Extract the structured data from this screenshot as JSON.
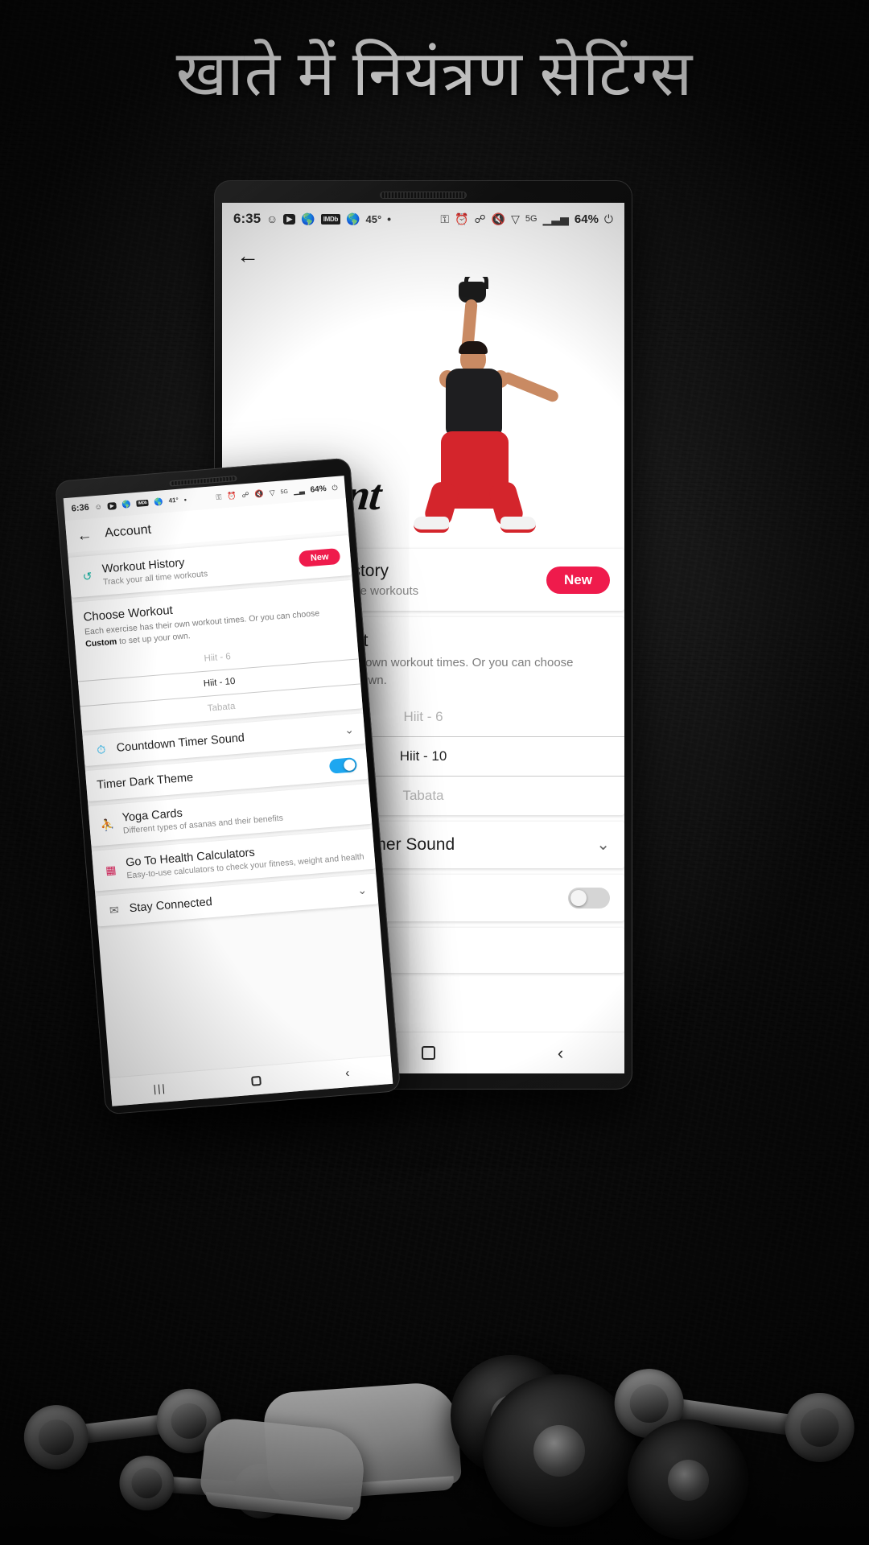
{
  "headline": "खाते में नियंत्रण सेटिंग्स",
  "colors": {
    "accent_red": "#ef1b4c",
    "accent_blue": "#1ea7f0",
    "teal": "#16b8a6",
    "backdrop": "#0b0b0b"
  },
  "tablet": {
    "status_bar": {
      "time": "6:35",
      "temperature": "45°",
      "battery": "64%",
      "left_icons": [
        "snapchat-icon",
        "youtube-icon",
        "globe-alert-icon",
        "imdb-icon",
        "globe-alert-icon-2",
        "dot-icon"
      ],
      "right_icons": [
        "vpn-key-icon",
        "alarm-icon",
        "bluetooth-icon",
        "mute-icon",
        "wifi-icon",
        "5g-icon",
        "signal-icon",
        "battery-icon"
      ]
    },
    "appbar": {
      "back_label": "←"
    },
    "hero": {
      "script_title": "Account"
    },
    "workout_history": {
      "title": "Workout History",
      "subtitle": "Track your all time workouts",
      "badge": "New"
    },
    "choose_workout": {
      "title": "Choose Workout",
      "desc_part1": "Each exercise has their own workout times. Or you can choose ",
      "desc_bold": "Custom",
      "desc_part2": " to set up your own.",
      "options": [
        "Hiit - 6",
        "Hiit - 10",
        "Tabata"
      ],
      "selected": "Hiit - 10"
    },
    "countdown_timer_sound": {
      "title": "Countdown Timer Sound",
      "chevron": "⌄"
    },
    "timer_dark_theme": {
      "title": "Timer Dark Theme",
      "state": "off"
    },
    "yoga_cards": {
      "title": "Yoga Cards"
    },
    "navbar": {
      "recents": "|||",
      "home": "home-icon",
      "back": "‹"
    }
  },
  "phone": {
    "status_bar": {
      "time": "6:36",
      "temperature": "41°",
      "battery": "64%"
    },
    "appbar": {
      "back_label": "←",
      "title": "Account"
    },
    "workout_history": {
      "title": "Workout History",
      "subtitle": "Track your all time workouts",
      "badge": "New"
    },
    "choose_workout": {
      "title": "Choose Workout",
      "desc_part1": "Each exercise has their own workout times. Or you can choose ",
      "desc_bold": "Custom",
      "desc_part2": " to set up your own.",
      "options": [
        "Hiit - 6",
        "Hiit - 10",
        "Tabata"
      ],
      "selected": "Hiit - 10"
    },
    "countdown_timer_sound": {
      "title": "Countdown Timer Sound",
      "chevron": "⌄"
    },
    "timer_dark_theme": {
      "title": "Timer Dark Theme",
      "state": "on"
    },
    "yoga_cards": {
      "title": "Yoga Cards",
      "subtitle": "Different types of asanas and their benefits"
    },
    "health_calculators": {
      "title": "Go To Health Calculators",
      "subtitle": "Easy-to-use calculators to check your fitness, weight and health"
    },
    "stay_connected": {
      "title": "Stay Connected",
      "chevron": "⌄"
    },
    "navbar": {
      "recents": "|||",
      "home": "home-icon",
      "back": "‹"
    }
  }
}
